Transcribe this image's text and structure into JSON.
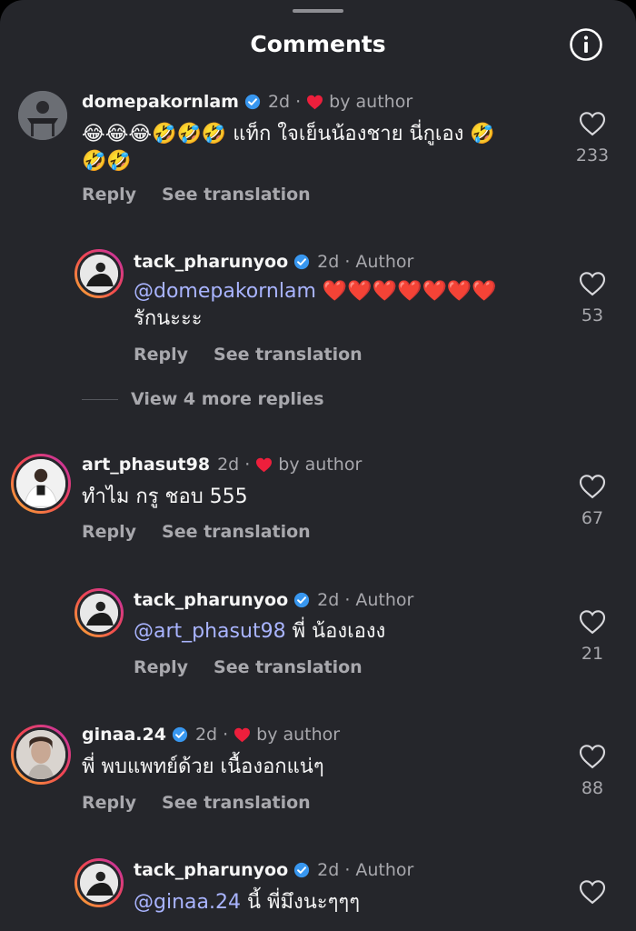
{
  "header": {
    "title": "Comments",
    "info_icon": "info-circle-icon"
  },
  "comments": [
    {
      "username": "domepakornlam",
      "verified": true,
      "time": "2d",
      "liked_by_author": true,
      "by_author": "by author",
      "emoji": "😂😂😂🤣🤣🤣",
      "text": "แท็ก ใจเย็นน้องชาย นี่กูเอง",
      "emoji_end": "🤣",
      "emoji_line2": "🤣🤣",
      "reply": "Reply",
      "see_translation": "See translation",
      "likes": "233"
    },
    {
      "username": "tack_pharunyoo",
      "verified": true,
      "time": "2d",
      "tag": "Author",
      "mention": "@domepakornlam",
      "hearts": "❤️❤️❤️❤️❤️❤️❤️",
      "text_line2": "รักนะะะ",
      "reply": "Reply",
      "see_translation": "See translation",
      "likes": "53"
    },
    {
      "username": "art_phasut98",
      "verified": false,
      "time": "2d",
      "liked_by_author": true,
      "by_author": "by author",
      "text": "ทำไม กรู ชอบ 555",
      "reply": "Reply",
      "see_translation": "See translation",
      "likes": "67"
    },
    {
      "username": "tack_pharunyoo",
      "verified": true,
      "time": "2d",
      "tag": "Author",
      "mention": "@art_phasut98",
      "text": "พี่ น้องเองง",
      "reply": "Reply",
      "see_translation": "See translation",
      "likes": "21"
    },
    {
      "username": "ginaa.24",
      "verified": true,
      "time": "2d",
      "liked_by_author": true,
      "by_author": "by author",
      "text": "พี่ พบแพทย์ด้วย เนื้องอกแน่ๆ",
      "reply": "Reply",
      "see_translation": "See translation",
      "likes": "88"
    },
    {
      "username": "tack_pharunyoo",
      "verified": true,
      "time": "2d",
      "tag": "Author",
      "mention": "@ginaa.24",
      "text": "นี้ พี่มึงนะๆๆๆ"
    }
  ],
  "view_more_replies": "View 4 more replies",
  "colors": {
    "background": "#25262b",
    "mention": "#a9b4ff",
    "verified": "#3897f0",
    "heart": "#ed1f3c",
    "secondary_text": "#a8a8ad"
  }
}
